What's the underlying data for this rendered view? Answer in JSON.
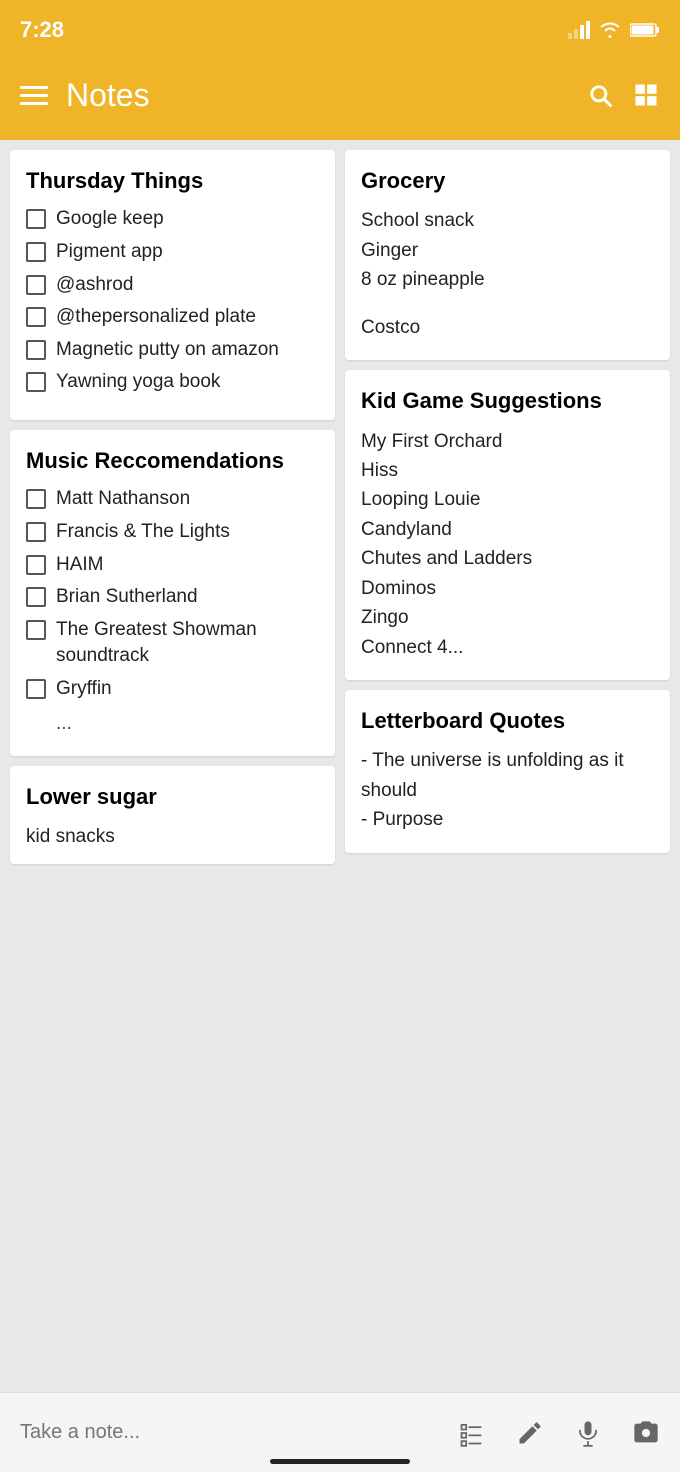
{
  "status": {
    "time": "7:28"
  },
  "header": {
    "title": "Notes"
  },
  "notes": {
    "left_col": [
      {
        "id": "thursday-things",
        "title": "Thursday Things",
        "type": "checklist",
        "items": [
          "Google keep",
          "Pigment app",
          "@ashrod",
          "@thepersonalized plate",
          "Magnetic putty on amazon",
          "Yawning yoga book"
        ]
      },
      {
        "id": "music-recommendations",
        "title": "Music Reccomendations",
        "type": "checklist",
        "items": [
          "Matt Nathanson",
          "Francis & The Lights",
          "HAIM",
          "Brian Sutherland",
          "The Greatest Showman soundtrack",
          "Gryffin"
        ],
        "ellipsis": "..."
      },
      {
        "id": "lower-sugar",
        "title": "Lower sugar",
        "type": "partial",
        "subtitle": "kid snacks"
      }
    ],
    "right_col": [
      {
        "id": "grocery",
        "title": "Grocery",
        "type": "text",
        "lines": [
          "School snack",
          "Ginger",
          "8 oz pineapple",
          "",
          "Costco"
        ]
      },
      {
        "id": "kid-game-suggestions",
        "title": "Kid Game Suggestions",
        "type": "text",
        "lines": [
          "My First Orchard",
          "Hiss",
          "Looping Louie",
          "Candyland",
          "Chutes and Ladders",
          "Dominos",
          "Zingo",
          "Connect 4..."
        ]
      },
      {
        "id": "letterboard-quotes",
        "title": "Letterboard Quotes",
        "type": "text",
        "lines": [
          "- The universe is unfolding as it should",
          "- Purpose"
        ]
      }
    ]
  },
  "bottom_bar": {
    "placeholder": "Take a note...",
    "icons": [
      "list-icon",
      "pencil-icon",
      "mic-icon",
      "camera-icon"
    ]
  }
}
